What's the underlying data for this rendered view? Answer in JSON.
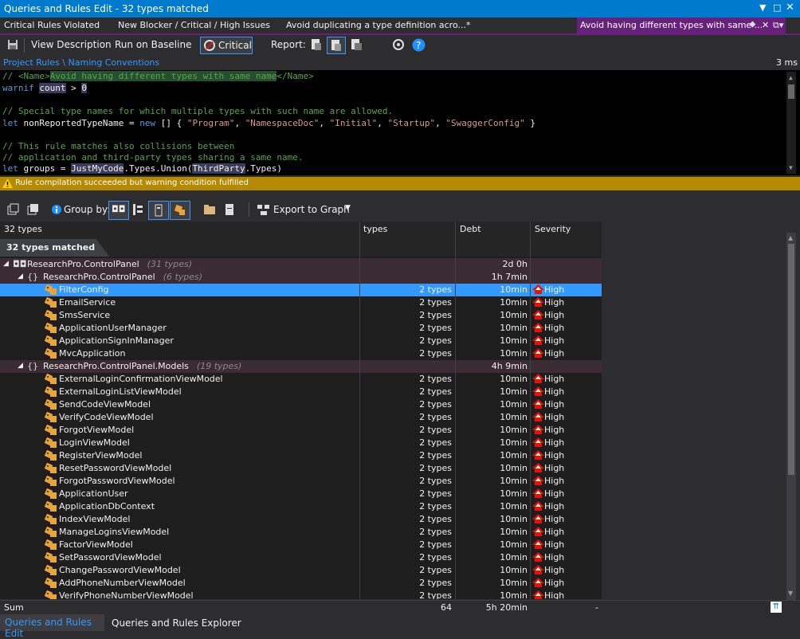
{
  "window": {
    "title": "Queries and Rules Edit  - 32 types matched"
  },
  "tabs": [
    {
      "label": "Critical Rules Violated"
    },
    {
      "label": "New Blocker / Critical / High Issues"
    },
    {
      "label": "Avoid duplicating a type definition acro...*"
    },
    {
      "label": "Avoid having different types with same ..."
    }
  ],
  "toolbar": {
    "view_description": "View Description",
    "run_on_baseline": "Run on Baseline",
    "critical": "Critical",
    "report": "Report:"
  },
  "breadcrumb": {
    "path": "Project Rules \\ Naming Conventions",
    "time": "3 ms"
  },
  "code": {
    "l1_cm": "// <Name>",
    "l1_name": "Avoid having different types with same name",
    "l1_end": "</Name>",
    "l2_kw": "warnif",
    "l2_count": "count",
    "l2_mid": " > ",
    "l2_zero": "0",
    "l4": "// Special type names for which multiple types with such name are allowed.",
    "l5_let": "let",
    "l5_a": " nonReportedTypeName = ",
    "l5_new": "new",
    "l5_b": " [] { ",
    "l5_s1": "\"Program\"",
    "l5_s2": "\"NamespaceDoc\"",
    "l5_s3": "\"Initial\"",
    "l5_s4": "\"Startup\"",
    "l5_s5": "\"SwaggerConfig\"",
    "l5_c": ", ",
    "l5_end": " }",
    "l7": "// This rule matches also collisions between",
    "l8": "// application and third-party types sharing a same name.",
    "l9_let": "let",
    "l9_a": " groups = ",
    "l9_jmc": "JustMyCode",
    "l9_b": ".Types.Union(",
    "l9_tp": "ThirdParty",
    "l9_c": ".Types)"
  },
  "status": {
    "message": "Rule compilation succeeded but warning condition fulfilled"
  },
  "results_toolbar": {
    "group_by": "Group by:",
    "export": "Export to Graph"
  },
  "grid": {
    "headers": {
      "name": "32 types",
      "types": "types",
      "debt": "Debt",
      "severity": "Severity"
    },
    "matched_label": "32 types matched",
    "groups": [
      {
        "name": "ResearchPro.ControlPanel",
        "count": "(31 types)",
        "debt": "2d  0h"
      },
      {
        "name": "ResearchPro.ControlPanel",
        "count": "(6 types)",
        "debt": "1h  7min"
      },
      {
        "name": "ResearchPro.ControlPanel.Models",
        "count": "(19 types)",
        "debt": "4h  9min"
      }
    ],
    "rows_ns1": [
      "FilterConfig",
      "EmailService",
      "SmsService",
      "ApplicationUserManager",
      "ApplicationSignInManager",
      "MvcApplication"
    ],
    "rows_ns2": [
      "ExternalLoginConfirmationViewModel",
      "ExternalLoginListViewModel",
      "SendCodeViewModel",
      "VerifyCodeViewModel",
      "ForgotViewModel",
      "LoginViewModel",
      "RegisterViewModel",
      "ResetPasswordViewModel",
      "ForgotPasswordViewModel",
      "ApplicationUser",
      "ApplicationDbContext",
      "IndexViewModel",
      "ManageLoginsViewModel",
      "FactorViewModel",
      "SetPasswordViewModel",
      "ChangePasswordViewModel",
      "AddPhoneNumberViewModel",
      "VerifyPhoneNumberViewModel"
    ],
    "row_types": "2 types",
    "row_debt": "10min",
    "row_severity": "High"
  },
  "summary": {
    "label": "Sum",
    "types": "64",
    "debt": "5h  20min",
    "severity": "-"
  },
  "bottom_tabs": [
    {
      "label": "Queries and Rules Edit"
    },
    {
      "label": "Queries and Rules Explorer"
    }
  ],
  "colors": {
    "accent": "#007acc",
    "active_tab": "#68217a",
    "selection": "#3399ff",
    "warning": "#b58a00",
    "high": "#e51400"
  }
}
